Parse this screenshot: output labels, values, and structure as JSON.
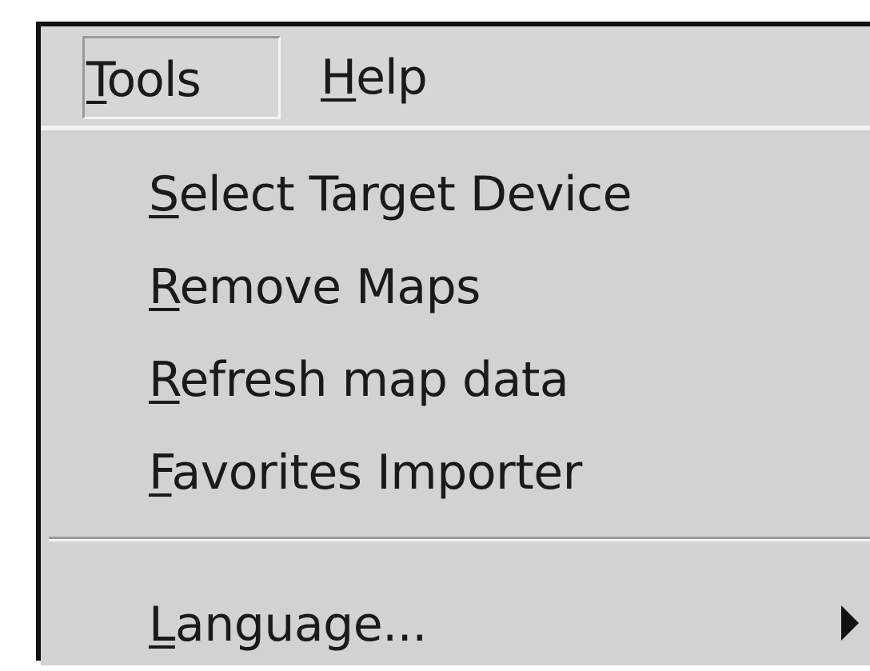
{
  "menubar": {
    "tools": {
      "label": "Tools",
      "mnemonic": "T",
      "rest": "ools"
    },
    "help": {
      "label": "Help",
      "mnemonic": "H",
      "rest": "elp"
    }
  },
  "tools_menu": {
    "items": [
      {
        "label": "Select Target Device",
        "mnemonic": "S",
        "rest": "elect Target Device"
      },
      {
        "label": "Remove Maps",
        "mnemonic": "R",
        "rest": "emove Maps"
      },
      {
        "label": "Refresh map data",
        "mnemonic": "R",
        "rest": "efresh map data"
      },
      {
        "label": "Favorites Importer",
        "mnemonic": "F",
        "rest": "avorites Importer"
      },
      {
        "label": "Language...",
        "mnemonic": "L",
        "rest": "anguage...",
        "has_submenu": true,
        "submenu_icon": "submenu-arrow-icon"
      }
    ]
  }
}
